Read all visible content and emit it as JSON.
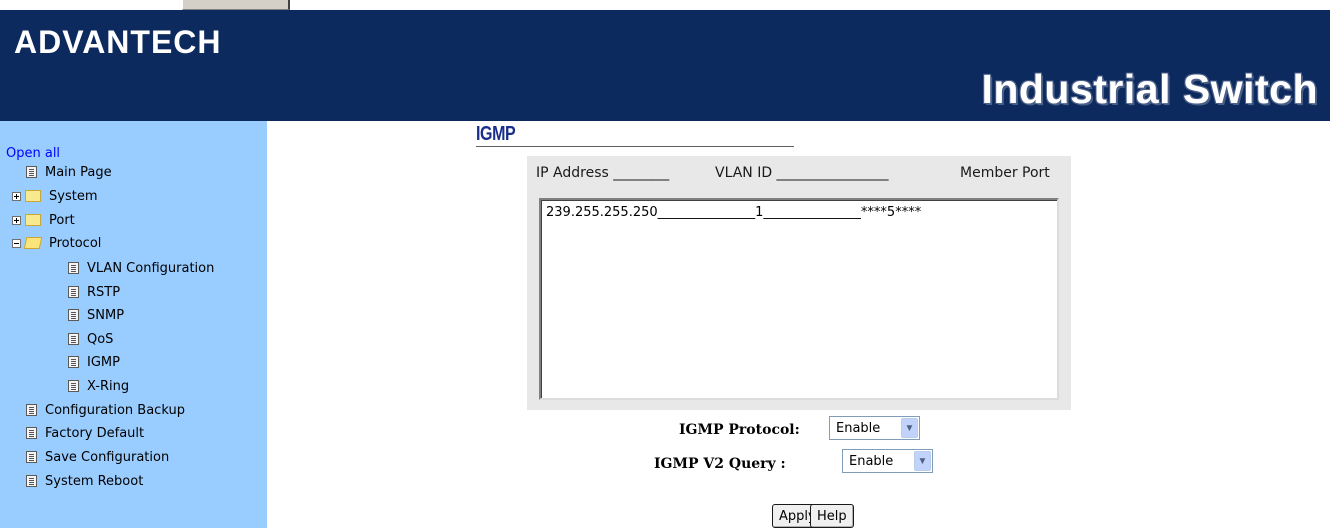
{
  "header": {
    "logo": "ADVANTECH",
    "product_title": "Industrial Switch"
  },
  "sidebar": {
    "open_all": "Open all",
    "items": [
      {
        "label": "Main Page",
        "icon": "page-icon"
      },
      {
        "label": "System",
        "icon": "folder-icon",
        "expander": "plus"
      },
      {
        "label": "Port",
        "icon": "folder-icon",
        "expander": "plus"
      },
      {
        "label": "Protocol",
        "icon": "open-folder-icon",
        "expander": "minus"
      },
      {
        "label": "VLAN Configuration",
        "icon": "page-icon"
      },
      {
        "label": "RSTP",
        "icon": "page-icon"
      },
      {
        "label": "SNMP",
        "icon": "page-icon"
      },
      {
        "label": "QoS",
        "icon": "page-icon"
      },
      {
        "label": "IGMP",
        "icon": "page-icon"
      },
      {
        "label": "X-Ring",
        "icon": "page-icon"
      },
      {
        "label": "Configuration Backup",
        "icon": "page-icon"
      },
      {
        "label": "Factory Default",
        "icon": "page-icon"
      },
      {
        "label": "Save Configuration",
        "icon": "page-icon"
      },
      {
        "label": "System Reboot",
        "icon": "page-icon"
      }
    ]
  },
  "main": {
    "title": "IGMP",
    "columns": {
      "ip": "IP Address ________",
      "vlan": "VLAN ID ________________",
      "member": "Member Port"
    },
    "entries": [
      "239.255.255.250_______________1_______________****5****"
    ],
    "igmp_protocol": {
      "label": "IGMP Protocol:",
      "value": "Enable"
    },
    "igmp_v2_query": {
      "label": "IGMP V2 Query  :",
      "value": "Enable"
    },
    "apply_label": "Apply",
    "help_label": "Help"
  }
}
